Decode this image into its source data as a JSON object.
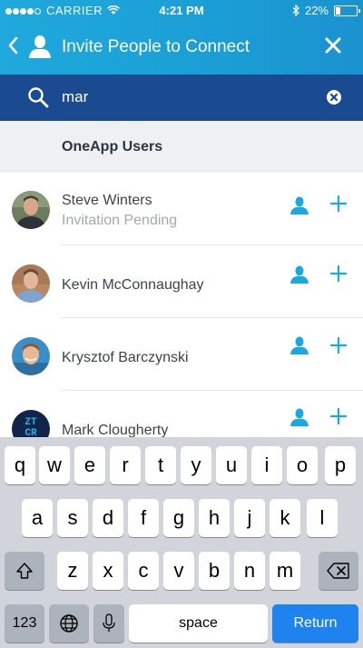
{
  "status_bar": {
    "carrier": "CARRIER",
    "time": "4:21 PM",
    "battery": "22%"
  },
  "header": {
    "title": "Invite People to Connect"
  },
  "search": {
    "value": "mar"
  },
  "section": {
    "label": "OneApp Users"
  },
  "contacts": [
    {
      "name": "Steve Winters",
      "status": "Invitation Pending"
    },
    {
      "name": "Kevin McConnaughay"
    },
    {
      "name": "Krysztof Barczynski"
    },
    {
      "name": "Mark Clougherty",
      "avatar_text_1": "ZT",
      "avatar_text_2": "CR"
    }
  ],
  "keyboard": {
    "row1": [
      "q",
      "w",
      "e",
      "r",
      "t",
      "y",
      "u",
      "i",
      "o",
      "p"
    ],
    "row2": [
      "a",
      "s",
      "d",
      "f",
      "g",
      "h",
      "j",
      "k",
      "l"
    ],
    "row3": [
      "z",
      "x",
      "c",
      "v",
      "b",
      "n",
      "m"
    ],
    "numbers_label": "123",
    "space_label": "space",
    "return_label": "Return"
  },
  "colors": {
    "header": "#1fa9dc",
    "search_bar": "#1a4a8f",
    "accent": "#19a8e0",
    "return_key": "#1f83ef"
  }
}
